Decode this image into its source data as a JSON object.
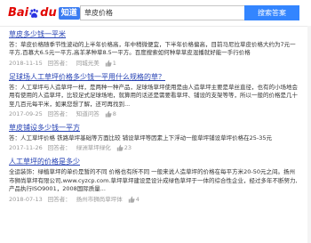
{
  "logo": {
    "bai": "Bai",
    "du": "du",
    "zhidao": "知道"
  },
  "search": {
    "value": "草皮价格",
    "button_label": "搜索答案"
  },
  "results": [
    {
      "title": "草皮多少钱一平米",
      "desc": "答：草皮价格随季节性波动的上半年价格高，年中稍微便宜，下半年价格偏高，目前马尼拉草皮价格大约为7元一平方,百慕大6.5元一平方,高羊茅种草8.5一平方。百度搜索如何种草草皮混播就好能一手行价格",
      "date": "2018-11-15",
      "answerer": "回答者：",
      "org": "同城光美",
      "count": "1"
    },
    {
      "title": "足球场人工草坪价格多少钱一平用什么规格的草？",
      "desc": "答：人工草坪与人造草坪一样，是两种一种产品，足球场草坪使用是由人造草坪主要是草丝直径，也有的小场地会用有使用的人造草坪，比较足式足球场地，就算用的话还是需要看草坪、铺设的支架等等，所以一般的价格是几十至几百元每平米，如果您想了解，还可再找到...",
      "date": "2017-09-25",
      "answerer": "回答者：",
      "org": "知道问答",
      "count": "8"
    },
    {
      "title": "草皮铺设多少钱一平方",
      "desc": "答：人工草坪价格 铁路草坪基础等方面比较 铺设草坪等因素上下浮动一般草坪铺设草坪价格在25-35元",
      "date": "2017-11-26",
      "answerer": "回答者：",
      "org": "绿洲草坪绿化",
      "count": "23"
    },
    {
      "title": "人工草坪的价格是多少",
      "desc": "全运装饰：绿植草坪的单价是暂的不同 价格也有所不同 一般来说人造草坪的价格在每平方米20-50元之间。扬州市狮尚草坪有限公司,www.cyzcp.com.草坪草坪建设是设计成绿色草坪于一体的综合性企业，经过多年不断努力,产品执行ISO9001，2008国际质量...",
      "date": "2018-07-13",
      "answerer": "回答者：",
      "org": "扬州市狮尚草坪体",
      "count": "4"
    }
  ]
}
